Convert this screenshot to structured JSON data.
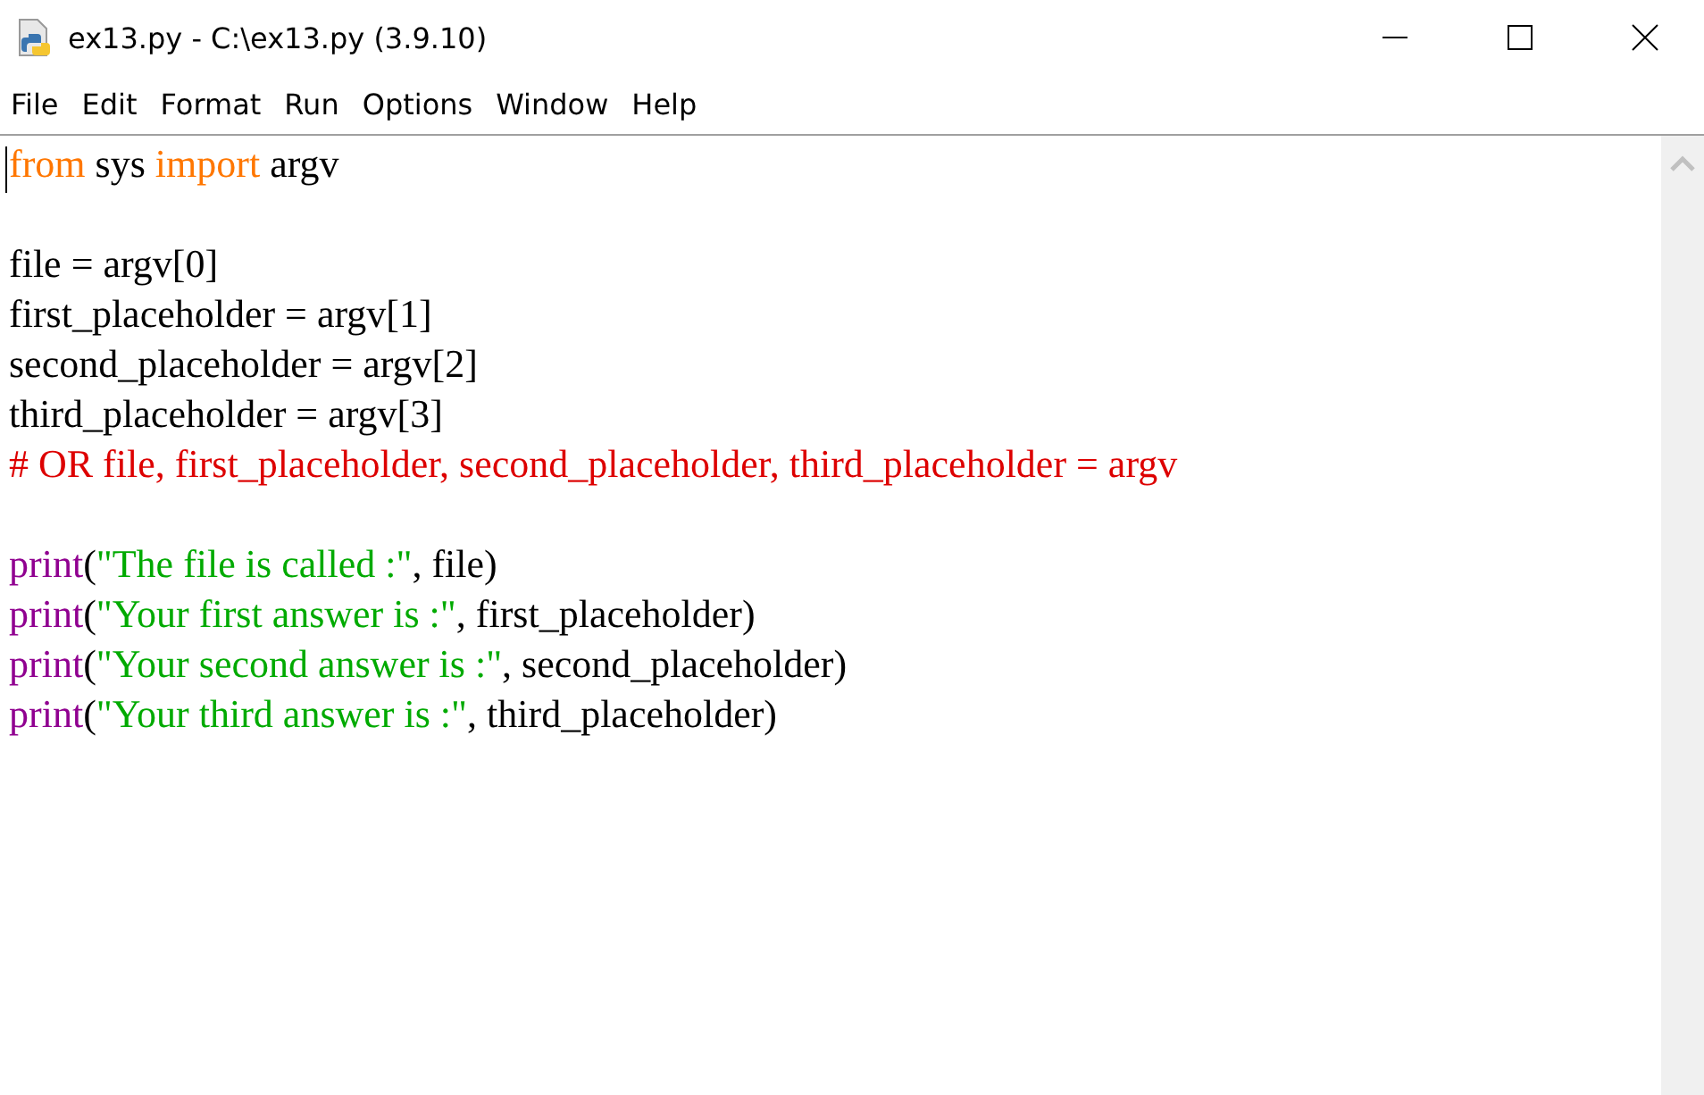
{
  "window": {
    "title": "ex13.py - C:\\ex13.py (3.9.10)"
  },
  "menu": [
    "File",
    "Edit",
    "Format",
    "Run",
    "Options",
    "Window",
    "Help"
  ],
  "editor": {
    "lines": [
      {
        "tokens": [
          {
            "kind": "keyword",
            "text": "from"
          },
          {
            "kind": "plain",
            "text": " sys "
          },
          {
            "kind": "keyword",
            "text": "import"
          },
          {
            "kind": "plain",
            "text": " argv"
          }
        ]
      },
      {
        "kind": "blank"
      },
      {
        "tokens": [
          {
            "kind": "plain",
            "text": "file = argv[0]"
          }
        ]
      },
      {
        "tokens": [
          {
            "kind": "plain",
            "text": "first_placeholder = argv[1]"
          }
        ]
      },
      {
        "tokens": [
          {
            "kind": "plain",
            "text": "second_placeholder = argv[2]"
          }
        ]
      },
      {
        "tokens": [
          {
            "kind": "plain",
            "text": "third_placeholder = argv[3]"
          }
        ]
      },
      {
        "tokens": [
          {
            "kind": "comment",
            "text": "# OR file, first_placeholder, second_placeholder, third_placeholder = argv"
          }
        ]
      },
      {
        "kind": "blank"
      },
      {
        "tokens": [
          {
            "kind": "builtin",
            "text": "print"
          },
          {
            "kind": "plain",
            "text": "("
          },
          {
            "kind": "string",
            "text": "\"The file is called :\""
          },
          {
            "kind": "plain",
            "text": ", file)"
          }
        ]
      },
      {
        "tokens": [
          {
            "kind": "builtin",
            "text": "print"
          },
          {
            "kind": "plain",
            "text": "("
          },
          {
            "kind": "string",
            "text": "\"Your first answer is :\""
          },
          {
            "kind": "plain",
            "text": ", first_placeholder)"
          }
        ]
      },
      {
        "tokens": [
          {
            "kind": "builtin",
            "text": "print"
          },
          {
            "kind": "plain",
            "text": "("
          },
          {
            "kind": "string",
            "text": "\"Your second answer is :\""
          },
          {
            "kind": "plain",
            "text": ", second_placeholder)"
          }
        ]
      },
      {
        "tokens": [
          {
            "kind": "builtin",
            "text": "print"
          },
          {
            "kind": "plain",
            "text": "("
          },
          {
            "kind": "string",
            "text": "\"Your third answer is :\""
          },
          {
            "kind": "plain",
            "text": ", third_placeholder)"
          }
        ]
      }
    ]
  }
}
